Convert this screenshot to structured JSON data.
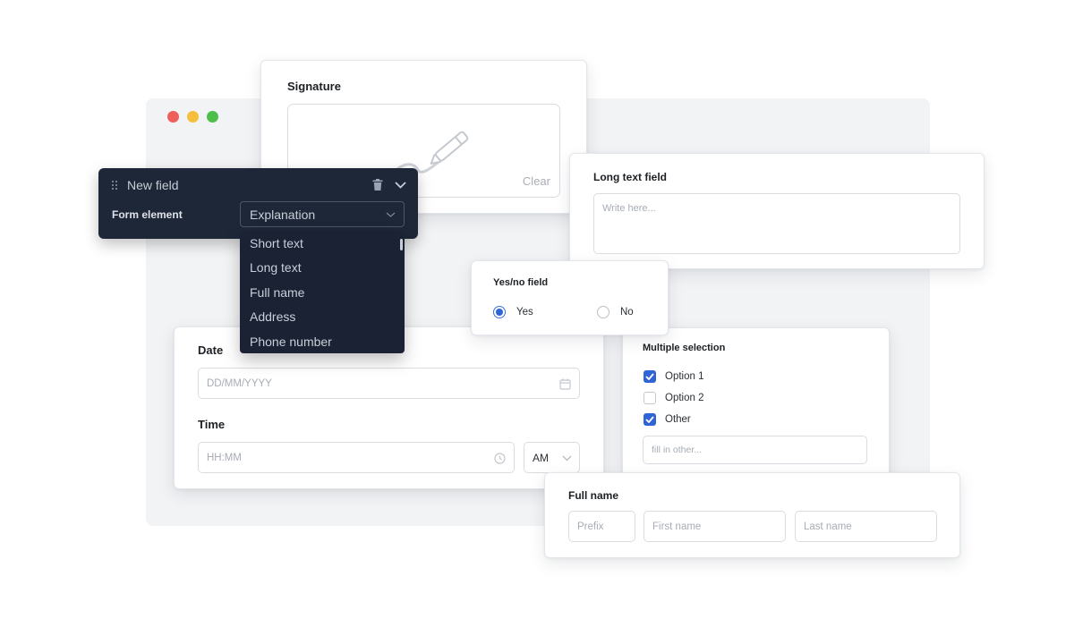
{
  "colors": {
    "dot_red": "#ee5f5b",
    "dot_yellow": "#f5bf3c",
    "dot_green": "#4cbf4a",
    "accent": "#2f64d4",
    "dark_panel": "#1d2738"
  },
  "signature": {
    "title": "Signature",
    "clear_label": "Clear",
    "icon": "pen-icon"
  },
  "new_field": {
    "title": "New field",
    "form_element_label": "Form element",
    "selected": "Explanation",
    "options": [
      "Short text",
      "Long text",
      "Full name",
      "Address",
      "Phone number"
    ],
    "icons": [
      "drag-handle-icon",
      "trash-icon",
      "chevron-down-icon"
    ]
  },
  "long_text": {
    "title": "Long text field",
    "placeholder": "Write here..."
  },
  "yes_no": {
    "title": "Yes/no field",
    "yes_label": "Yes",
    "no_label": "No",
    "selected": "Yes"
  },
  "date_time": {
    "date_title": "Date",
    "date_placeholder": "DD/MM/YYYY",
    "time_title": "Time",
    "time_placeholder": "HH:MM",
    "ampm": "AM"
  },
  "multiple_selection": {
    "title": "Multiple selection",
    "options": [
      {
        "label": "Option 1",
        "checked": true
      },
      {
        "label": "Option 2",
        "checked": false
      },
      {
        "label": "Other",
        "checked": true
      }
    ],
    "other_placeholder": "fill in other..."
  },
  "full_name": {
    "title": "Full name",
    "prefix_placeholder": "Prefix",
    "first_placeholder": "First name",
    "last_placeholder": "Last name"
  }
}
